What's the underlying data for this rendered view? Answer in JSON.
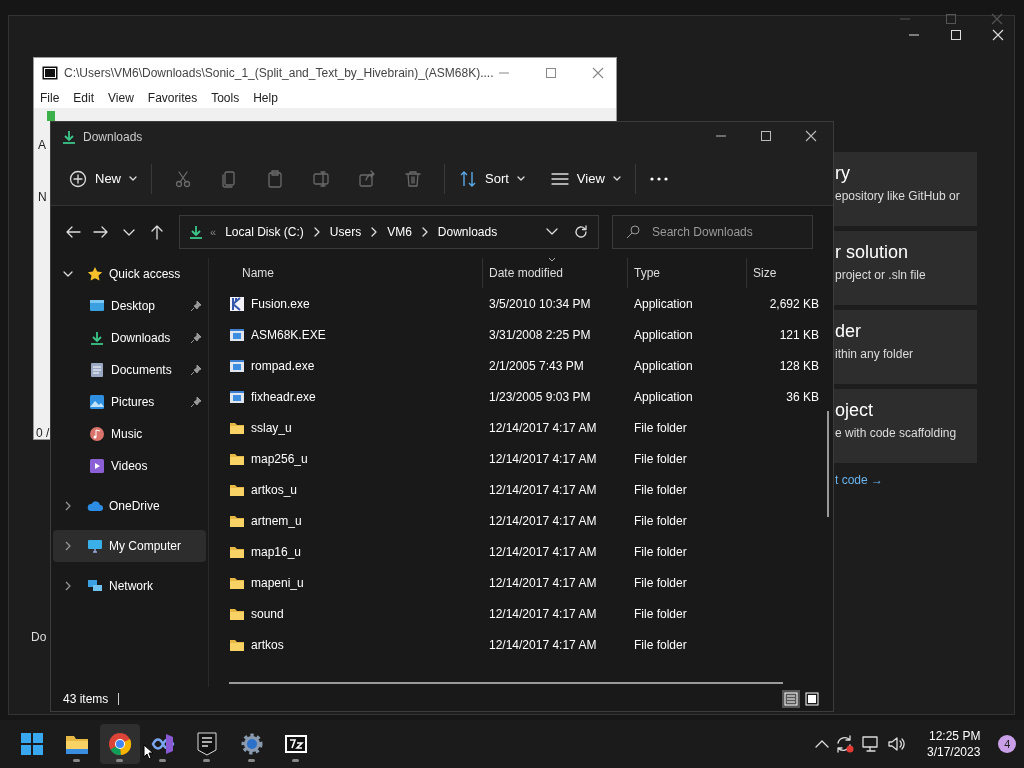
{
  "background_window": {
    "cards": [
      {
        "title": "ry",
        "subtitle": "epository like GitHub or"
      },
      {
        "title": "r solution",
        "subtitle": "project or .sln file"
      },
      {
        "title": "der",
        "subtitle": "ithin any folder"
      },
      {
        "title": "oject",
        "subtitle": "e with code scaffolding"
      }
    ],
    "link": "t code →",
    "footer_fragment": "Do"
  },
  "archive_window": {
    "title": "C:\\Users\\VM6\\Downloads\\Sonic_1_(Split_and_Text_by_Hivebrain)_(ASM68K)....",
    "menu": [
      "File",
      "Edit",
      "View",
      "Favorites",
      "Tools",
      "Help"
    ],
    "fragments": [
      "A",
      "N",
      "0 /"
    ]
  },
  "explorer": {
    "title": "Downloads",
    "toolbar": {
      "new": "New",
      "sort": "Sort",
      "view": "View"
    },
    "address": {
      "overflow": "«",
      "segments": [
        "Local Disk (C:)",
        "Users",
        "VM6",
        "Downloads"
      ]
    },
    "search": {
      "placeholder": "Search Downloads"
    },
    "nav": [
      {
        "label": "Quick access",
        "expanded": true,
        "selected": false,
        "children": [
          {
            "label": "Desktop",
            "pinned": true
          },
          {
            "label": "Downloads",
            "pinned": true
          },
          {
            "label": "Documents",
            "pinned": true
          },
          {
            "label": "Pictures",
            "pinned": true
          },
          {
            "label": "Music",
            "pinned": false
          },
          {
            "label": "Videos",
            "pinned": false
          }
        ]
      },
      {
        "label": "OneDrive",
        "expanded": false,
        "selected": false
      },
      {
        "label": "My Computer",
        "expanded": false,
        "selected": true
      },
      {
        "label": "Network",
        "expanded": false,
        "selected": false
      }
    ],
    "columns": [
      {
        "label": "Name",
        "sorted": false
      },
      {
        "label": "Date modified",
        "sorted": true
      },
      {
        "label": "Type",
        "sorted": false
      },
      {
        "label": "Size",
        "sorted": false
      }
    ],
    "rows": [
      {
        "kind": "kapp",
        "name": "Fusion.exe",
        "date": "3/5/2010 10:34 PM",
        "type": "Application",
        "size": "2,692 KB"
      },
      {
        "kind": "app",
        "name": "ASM68K.EXE",
        "date": "3/31/2008 2:25 PM",
        "type": "Application",
        "size": "121 KB"
      },
      {
        "kind": "app",
        "name": "rompad.exe",
        "date": "2/1/2005 7:43 PM",
        "type": "Application",
        "size": "128 KB"
      },
      {
        "kind": "app",
        "name": "fixheadr.exe",
        "date": "1/23/2005 9:03 PM",
        "type": "Application",
        "size": "36 KB"
      },
      {
        "kind": "folder",
        "name": "sslay_u",
        "date": "12/14/2017 4:17 AM",
        "type": "File folder"
      },
      {
        "kind": "folder",
        "name": "map256_u",
        "date": "12/14/2017 4:17 AM",
        "type": "File folder"
      },
      {
        "kind": "folder",
        "name": "artkos_u",
        "date": "12/14/2017 4:17 AM",
        "type": "File folder"
      },
      {
        "kind": "folder",
        "name": "artnem_u",
        "date": "12/14/2017 4:17 AM",
        "type": "File folder"
      },
      {
        "kind": "folder",
        "name": "map16_u",
        "date": "12/14/2017 4:17 AM",
        "type": "File folder"
      },
      {
        "kind": "folder",
        "name": "mapeni_u",
        "date": "12/14/2017 4:17 AM",
        "type": "File folder"
      },
      {
        "kind": "folder",
        "name": "sound",
        "date": "12/14/2017 4:17 AM",
        "type": "File folder"
      },
      {
        "kind": "folder",
        "name": "artkos",
        "date": "12/14/2017 4:17 AM",
        "type": "File folder"
      }
    ],
    "status": "43 items",
    "view_toggles": [
      {
        "kind": "details",
        "selected": true
      },
      {
        "kind": "tiles",
        "selected": false
      }
    ]
  },
  "taskbar": {
    "apps": [
      {
        "kind": "start",
        "running": false,
        "hovered": false
      },
      {
        "kind": "explorer",
        "running": true,
        "hovered": false
      },
      {
        "kind": "chrome",
        "running": true,
        "hovered": true
      },
      {
        "kind": "studio",
        "running": true,
        "hovered": false
      },
      {
        "kind": "epic",
        "running": true,
        "hovered": false
      },
      {
        "kind": "settings",
        "running": true,
        "hovered": false
      },
      {
        "kind": "archiver",
        "running": true,
        "hovered": false
      }
    ],
    "time": "12:25 PM",
    "date": "3/17/2023",
    "notifications": "4"
  }
}
